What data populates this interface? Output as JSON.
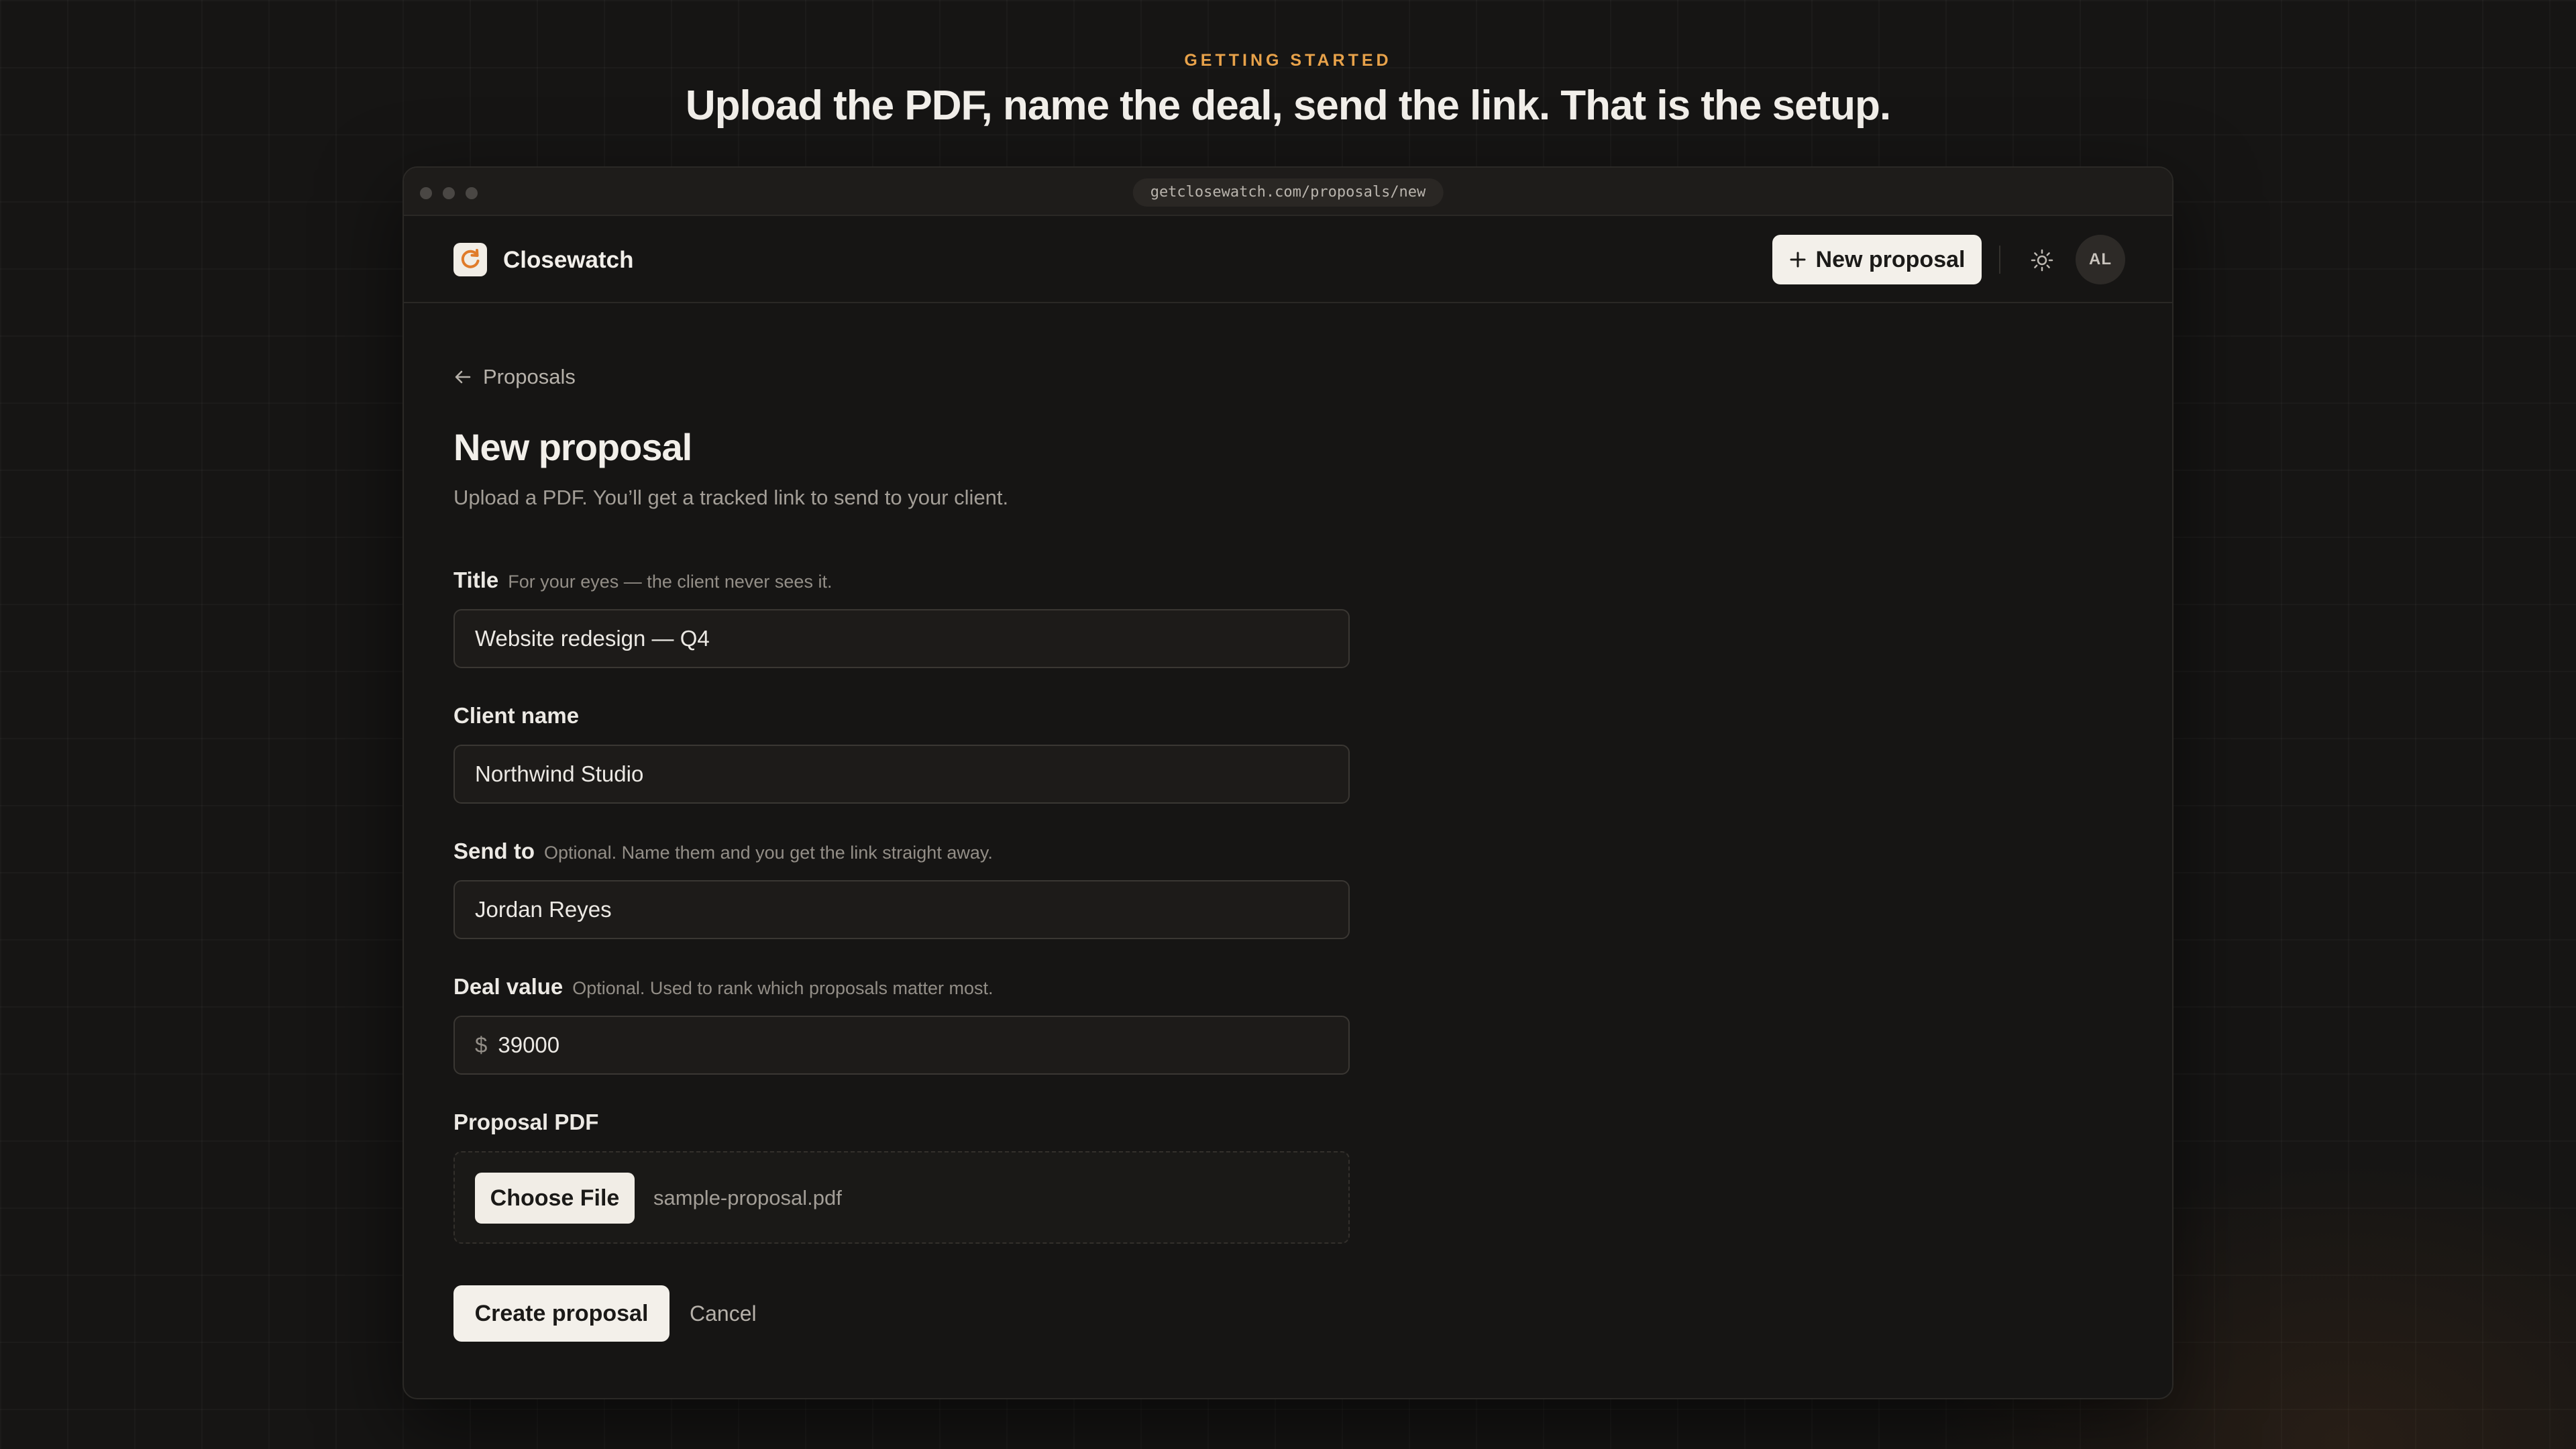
{
  "hero": {
    "eyebrow": "GETTING STARTED",
    "headline": "Upload the PDF, name the deal, send the link. That is the setup."
  },
  "browser": {
    "url": "getclosewatch.com/proposals/new"
  },
  "appbar": {
    "brand": "Closewatch",
    "new_proposal_label": "New proposal",
    "avatar_initials": "AL"
  },
  "page": {
    "back_label": "Proposals",
    "title": "New proposal",
    "subtitle": "Upload a PDF. You’ll get a tracked link to send to your client."
  },
  "form": {
    "title_field": {
      "label": "Title",
      "hint": "For your eyes — the client never sees it.",
      "value": "Website redesign — Q4"
    },
    "client_field": {
      "label": "Client name",
      "value": "Northwind Studio"
    },
    "send_to_field": {
      "label": "Send to",
      "hint": "Optional. Name them and you get the link straight away.",
      "value": "Jordan Reyes"
    },
    "deal_value_field": {
      "label": "Deal value",
      "hint": "Optional. Used to rank which proposals matter most.",
      "currency": "$",
      "value": "39000"
    },
    "pdf_field": {
      "label": "Proposal PDF",
      "choose_label": "Choose File",
      "file_name": "sample-proposal.pdf"
    },
    "create_label": "Create proposal",
    "cancel_label": "Cancel"
  },
  "colors": {
    "accent": "#e8a24a",
    "background": "#161514",
    "button": "#f3f0ea"
  }
}
